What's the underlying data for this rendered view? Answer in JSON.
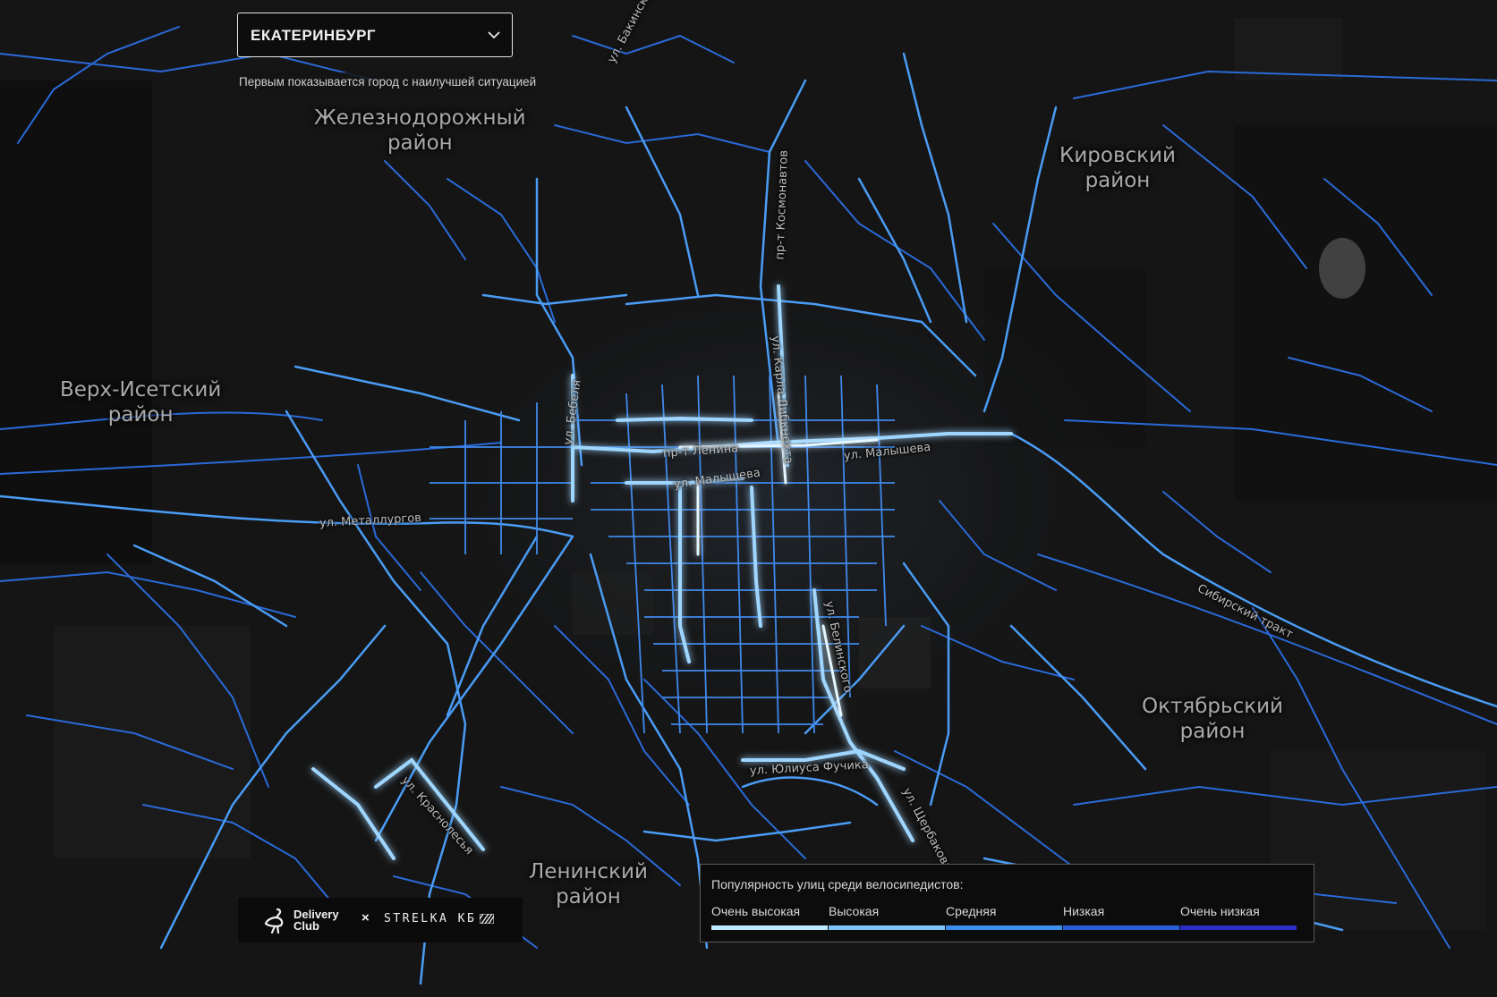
{
  "city_selector": {
    "value": "ЕКАТЕРИНБУРГ",
    "hint": "Первым показывается город с наилучшей ситуацией"
  },
  "districts": {
    "zheleznodorozhny": {
      "line1": "Железнодорожный",
      "line2": "район"
    },
    "kirovsky": {
      "line1": "Кировский",
      "line2": "район"
    },
    "verkh_isetsky": {
      "line1": "Верх-Исетский",
      "line2": "район"
    },
    "oktyabrsky": {
      "line1": "Октябрьский",
      "line2": "район"
    },
    "leninsky": {
      "line1": "Ленинский",
      "line2": "район"
    }
  },
  "streets": {
    "bakinskikh": "ул. Бакинских",
    "kosmonavtov": "пр-т Космонавтов",
    "karla_libknekhta": "ул. Карла Либкнехта",
    "bebelya": "ул. Бебеля",
    "lenina": "пр-т Ленина",
    "malysheva_w": "ул. Малышева",
    "malysheva_e": "ул. Малышева",
    "metallurgov": "ул. Металлургов",
    "sibirsky": "Сибирский тракт",
    "belinskogo": "ул. Белинского",
    "fuchika": "ул. Юлиуса Фучика",
    "shcherbakova": "ул. Щербакова",
    "krasnolesya": "ул. Краснолесья"
  },
  "logos": {
    "delivery_line1": "Delivery",
    "delivery_line2": "Club",
    "times": "×",
    "strelka": "STRELKA КБ"
  },
  "legend": {
    "title": "Популярность улиц среди велосипедистов:",
    "categories": [
      {
        "label": "Очень высокая",
        "color": "#bfe9ff"
      },
      {
        "label": "Высокая",
        "color": "#7fc4ff"
      },
      {
        "label": "Средняя",
        "color": "#3d8ff0"
      },
      {
        "label": "Низкая",
        "color": "#2a5fd8"
      },
      {
        "label": "Очень низкая",
        "color": "#2b2fc8"
      }
    ]
  },
  "colors": {
    "background": "#121212",
    "road_low": "#2a6ad8",
    "road_mid": "#4a9cf5",
    "road_high": "#9fd6ff",
    "road_glow": "#d8f2ff"
  }
}
